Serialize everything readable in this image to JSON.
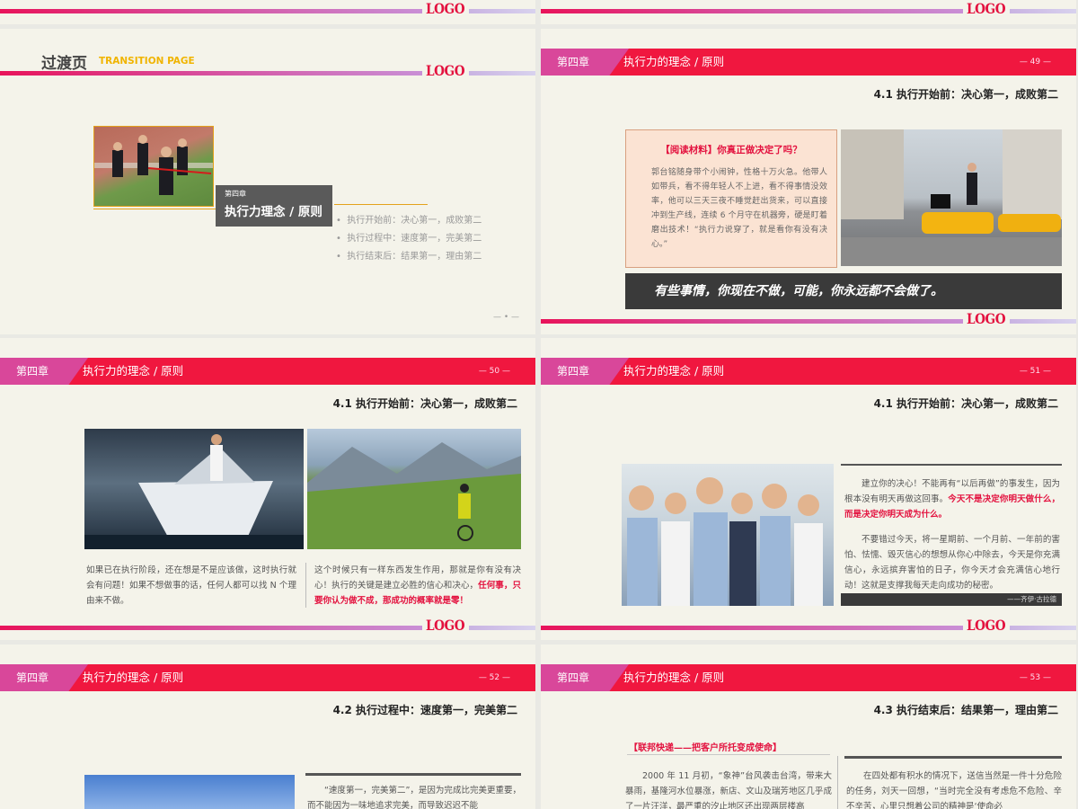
{
  "brand": {
    "logo": "LOGO",
    "accent": "#f0173f",
    "pink": "#d9479a"
  },
  "chapter_label": "第四章",
  "section_title": "执行力的理念 / 原则",
  "transition": {
    "title": "过渡页",
    "title_en": "TRANSITION PAGE",
    "chapter": "第四章",
    "heading": "执行力理念 / 原则",
    "bullets": [
      "执行开始前：决心第一，成败第二",
      "执行过程中：速度第一，完美第二",
      "执行结束后：结果第一，理由第二"
    ],
    "page": "— • —"
  },
  "s49": {
    "page": "— 49 —",
    "subtitle": "4.1  执行开始前：决心第一，成败第二",
    "box_title": "【阅读材料】你真正做决定了吗？",
    "box_text": "郭台铭随身带个小闹钟，性格十万火急。他带人如带兵，看不得年轻人不上进，看不得事情没效率，他可以三天三夜不睡觉赶出货来，可以直接冲到生产线，连续 6 个月守在机器旁，硬是盯着磨出技术！“执行力说穿了，就是看你有没有决心。”",
    "banner": "有些事情，你现在不做，可能，你永远都不会做了。"
  },
  "s50": {
    "page": "— 50 —",
    "subtitle": "4.1  执行开始前：决心第一，成败第二",
    "left_text": "如果已在执行阶段，还在想是不是应该做，这时执行就会有问题！如果不想做事的话，任何人都可以找 N 个理由来不做。",
    "right_text": "这个时候只有一样东西发生作用，那就是你有没有决心！执行的关键是建立必胜的信心和决心，",
    "right_red": "任何事，只要你认为做不成，那成功的概率就是零！"
  },
  "s51": {
    "page": "— 51 —",
    "subtitle": "4.1  执行开始前：决心第一，成败第二",
    "p1": "建立你的决心！不能再有“以后再做”的事发生，因为根本没有明天再做这回事。",
    "p1_red": "今天不是决定你明天做什么，而是决定你明天成为什么。",
    "p2": "不要错过今天，将一星期前、一个月前、一年前的害怕、怯懦、毁灭信心的想想从你心中除去，今天是你充满信心，永远摈弃害怕的日子，你今天才会充满信心地行动！这就是支撑我每天走向成功的秘密。",
    "author": "——齐伊·古拉德"
  },
  "s52": {
    "page": "— 52 —",
    "subtitle": "4.2  执行过程中：速度第一，完美第二",
    "text": "“速度第一，完美第二”，是因为完成比完美更重要，而不能因为一味地追求完美，而导致迟迟不能"
  },
  "s53": {
    "page": "— 53 —",
    "subtitle": "4.3  执行结束后：结果第一，理由第二",
    "case_title": "【联邦快递——把客户所托变成使命】",
    "left_text": "2000 年 11 月初，“象神”台风袭击台湾，带来大暴雨，基隆河水位暴涨，新店、文山及瑞芳地区几乎成了一片汪洋，最严重的汐止地区还出现两层楼高",
    "right_text": "在四处都有积水的情况下，送信当然是一件十分危险的任务，刘天一回想，“当时完全没有考虑危不危险、辛不辛苦，心里只想着公司的精神是‘使命必"
  }
}
